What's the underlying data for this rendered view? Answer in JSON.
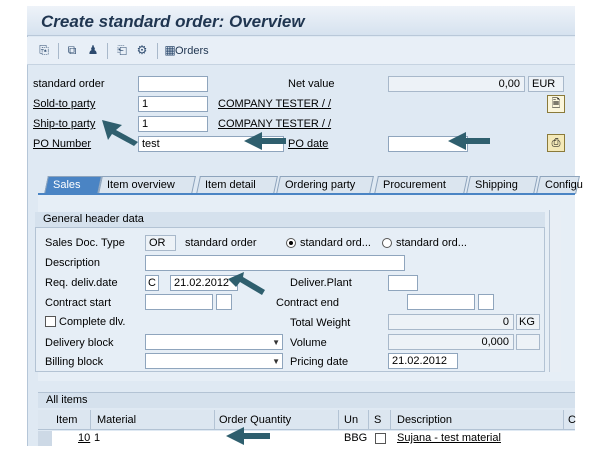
{
  "title": "Create standard order: Overview",
  "toolbar": {
    "orders_label": "Orders"
  },
  "header": {
    "standard_order_label": "standard order",
    "standard_order_value": "",
    "net_value_label": "Net value",
    "net_value": "0,00",
    "currency": "EUR",
    "sold_to_label": "Sold-to party",
    "sold_to_value": "1",
    "sold_to_name": "COMPANY TESTER / /",
    "ship_to_label": "Ship-to party",
    "ship_to_value": "1",
    "ship_to_name": "COMPANY TESTER / /",
    "po_number_label": "PO Number",
    "po_number_value": "test",
    "po_date_label": "PO date",
    "po_date_value": ""
  },
  "tabs": [
    {
      "label": "Sales",
      "active": true
    },
    {
      "label": "Item overview"
    },
    {
      "label": "Item detail"
    },
    {
      "label": "Ordering party"
    },
    {
      "label": "Procurement"
    },
    {
      "label": "Shipping"
    },
    {
      "label": "Configu"
    }
  ],
  "general": {
    "group_title": "General header data",
    "sales_doc_type_label": "Sales Doc. Type",
    "sales_doc_type_value": "OR",
    "sales_doc_type_text": "standard order",
    "radio1_label": "standard ord...",
    "radio2_label": "standard ord...",
    "description_label": "Description",
    "req_deliv_label": "Req. deliv.date",
    "req_deliv_type": "C",
    "req_deliv_date": "21.02.2012",
    "deliver_plant_label": "Deliver.Plant",
    "contract_start_label": "Contract start",
    "contract_end_label": "Contract end",
    "complete_dlv_label": "Complete dlv.",
    "total_weight_label": "Total Weight",
    "total_weight_value": "0",
    "total_weight_unit": "KG",
    "delivery_block_label": "Delivery block",
    "volume_label": "Volume",
    "volume_value": "0,000",
    "billing_block_label": "Billing block",
    "pricing_date_label": "Pricing date",
    "pricing_date_value": "21.02.2012"
  },
  "items": {
    "bar_label": "All items",
    "columns": [
      "Item",
      "Material",
      "Order Quantity",
      "Un",
      "S",
      "Description",
      "C"
    ],
    "rows": [
      {
        "item": "10",
        "material": "1",
        "quantity": "",
        "unit": "BBG",
        "description": "Sujana - test material"
      }
    ]
  }
}
